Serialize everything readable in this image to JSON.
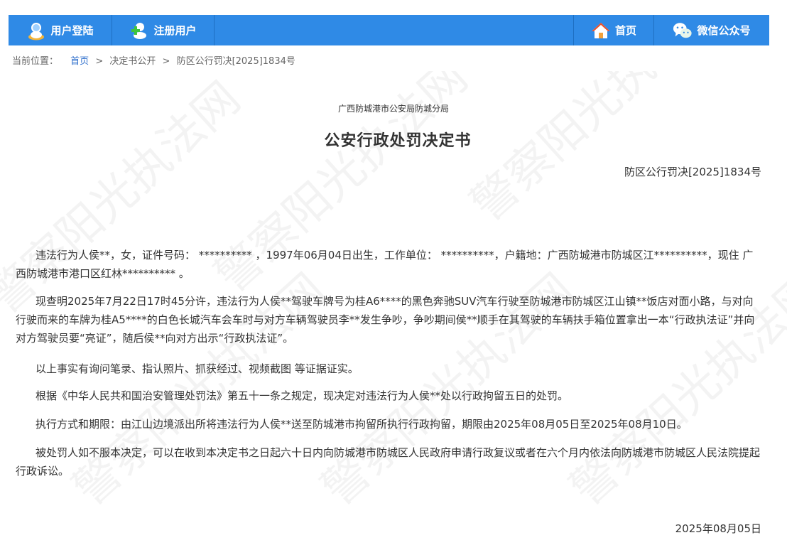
{
  "nav": {
    "login": "用户登陆",
    "register": "注册用户",
    "home": "首页",
    "wechat": "微信公众号",
    "bar_color": "#2f8ae6"
  },
  "breadcrumb": {
    "label": "当前位置：",
    "items": [
      "首页",
      "决定书公开",
      "防区公行罚决[2025]1834号"
    ],
    "separator": ">"
  },
  "watermark": {
    "text": "警察阳光执法网"
  },
  "document": {
    "issuer": "广西防城港市公安局防城分局",
    "title": "公安行政处罚决定书",
    "number": "防区公行罚决[2025]1834号",
    "paragraphs": [
      "违法行为人侯**，女，证件号码： **********  ，1997年06月04日出生，工作单位： **********，户籍地：广西防城港市防城区江**********，现住 广西防城港市港口区红林**********    。",
      "现查明2025年7月22日17时45分许，违法行为人侯**驾驶车牌号为桂A6****的黑色奔驰SUV汽车行驶至防城港市防城区江山镇**饭店对面小路，与对向行驶而来的车牌为桂A5****的白色长城汽车会车时与对方车辆驾驶员李**发生争吵，争吵期间侯**顺手在其驾驶的车辆扶手箱位置拿出一本“行政执法证”并向对方驾驶员要“亮证”，随后侯**向对方出示“行政执法证”。",
      "以上事实有询问笔录、指认照片、抓获经过、视频截图 等证据证实。",
      "根据《中华人民共和国治安管理处罚法》第五十一条之规定，现决定对违法行为人侯**处以行政拘留五日的处罚。",
      "执行方式和期限：由江山边境派出所将违法行为人侯**送至防城港市拘留所执行行政拘留，期限由2025年08月05日至2025年08月10日。",
      "被处罚人如不服本决定，可以在收到本决定书之日起六十日内向防城港市防城区人民政府申请行政复议或者在六个月内依法向防城港市防城区人民法院提起行政诉讼。"
    ],
    "date": "2025年08月05日"
  }
}
